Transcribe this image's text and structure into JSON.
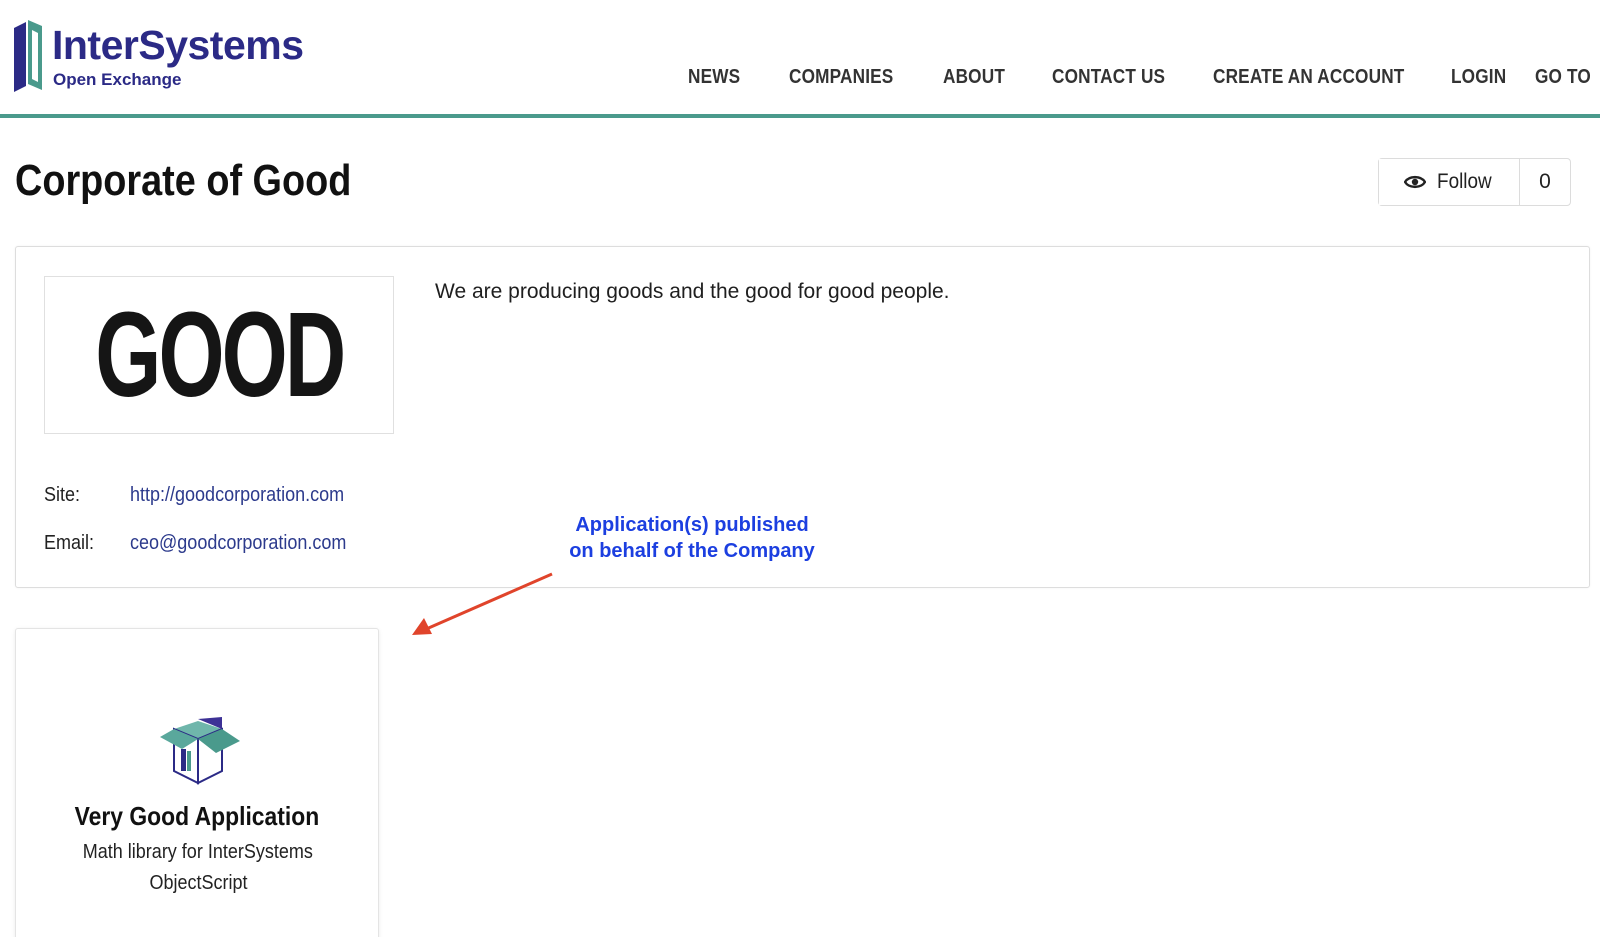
{
  "header": {
    "logo_title": "InterSystems",
    "logo_subtitle": "Open Exchange",
    "nav": [
      {
        "label": "NEWS"
      },
      {
        "label": "COMPANIES"
      },
      {
        "label": "ABOUT"
      },
      {
        "label": "CONTACT US"
      },
      {
        "label": "CREATE AN ACCOUNT"
      },
      {
        "label": "LOGIN"
      },
      {
        "label": "GO TO"
      }
    ]
  },
  "page": {
    "title": "Corporate of Good",
    "follow_label": "Follow",
    "follow_count": "0"
  },
  "company": {
    "logo_text": "GOOD",
    "description": "We are producing goods and the good for good people.",
    "site_label": "Site:",
    "site_url": "http://goodcorporation.com",
    "email_label": "Email:",
    "email": "ceo@goodcorporation.com"
  },
  "annotation": {
    "line1": "Application(s) published",
    "line2": "on behalf of the Company"
  },
  "app": {
    "name": "Very Good Application",
    "description_line1": "Math library for InterSystems",
    "description_line2": "ObjectScript"
  },
  "colors": {
    "brand": "#2b2a86",
    "header_border": "#4a9a8c",
    "link": "#2c3a8c",
    "annotation_text": "#1c3fe0",
    "annotation_arrow": "#e0442b"
  },
  "icons": {
    "follow": "eye-icon",
    "app": "package-box-icon",
    "logo": "intersystems-logo-mark-icon"
  }
}
